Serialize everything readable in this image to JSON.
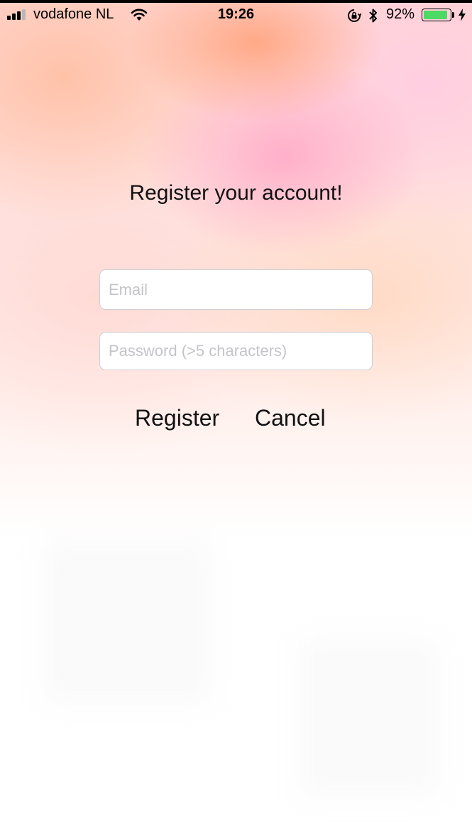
{
  "status_bar": {
    "carrier": "vodafone NL",
    "time": "19:26",
    "battery_percent": "92%",
    "battery_level": 0.92,
    "icons": [
      "signal-icon",
      "wifi-icon",
      "orientation-lock-icon",
      "bluetooth-icon",
      "battery-icon",
      "charging-bolt-icon"
    ]
  },
  "register": {
    "title": "Register your account!",
    "email_placeholder": "Email",
    "email_value": "",
    "password_placeholder": "Password (>5 characters)",
    "password_value": "",
    "register_label": "Register",
    "cancel_label": "Cancel"
  },
  "colors": {
    "battery_fill": "#4cd964",
    "text": "#111111",
    "placeholder": "#c4c4c9"
  }
}
